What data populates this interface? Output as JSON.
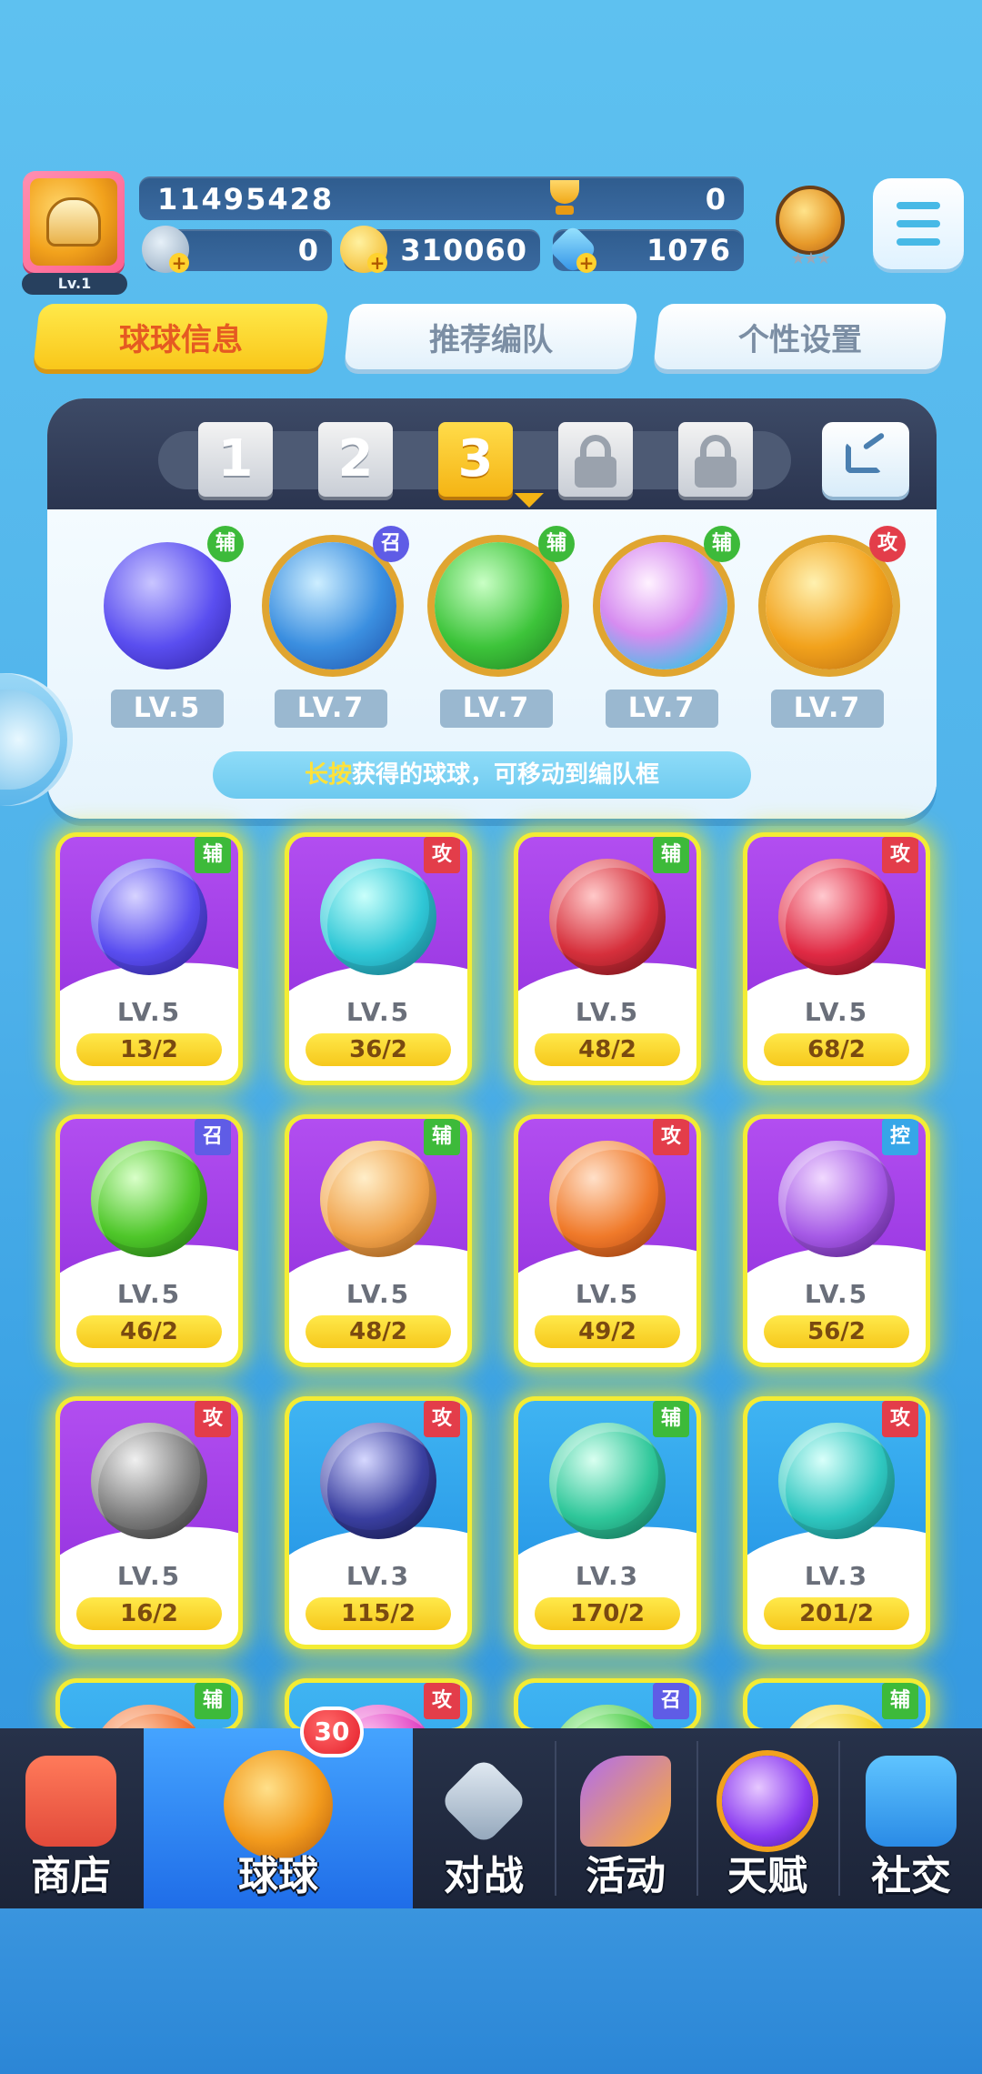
{
  "player": {
    "level": "Lv.1",
    "score": "11495428",
    "trophies": "0"
  },
  "resources": {
    "energy": "0",
    "coins": "310060",
    "gems": "1076"
  },
  "tabs": {
    "ball_info": "球球信息",
    "recommended_team": "推荐编队",
    "personal_settings": "个性设置"
  },
  "team_slots": [
    "1",
    "2",
    "3"
  ],
  "team": [
    {
      "level": "LV.5",
      "tag": "辅",
      "tag_color": "#3dba3a"
    },
    {
      "level": "LV.7",
      "tag": "召",
      "tag_color": "#5f5ce6"
    },
    {
      "level": "LV.7",
      "tag": "辅",
      "tag_color": "#3dba3a"
    },
    {
      "level": "LV.7",
      "tag": "辅",
      "tag_color": "#3dba3a"
    },
    {
      "level": "LV.7",
      "tag": "攻",
      "tag_color": "#e33d4a"
    }
  ],
  "hint": {
    "highlight": "长按",
    "text": "获得的球球，可移动到编队框"
  },
  "cards": [
    {
      "level": "LV.5",
      "count": "13/2",
      "tag": "辅",
      "tag_color": "#3dba3a"
    },
    {
      "level": "LV.5",
      "count": "36/2",
      "tag": "攻",
      "tag_color": "#e33d4a"
    },
    {
      "level": "LV.5",
      "count": "48/2",
      "tag": "辅",
      "tag_color": "#3dba3a"
    },
    {
      "level": "LV.5",
      "count": "68/2",
      "tag": "攻",
      "tag_color": "#e33d4a"
    },
    {
      "level": "LV.5",
      "count": "46/2",
      "tag": "召",
      "tag_color": "#5f5ce6"
    },
    {
      "level": "LV.5",
      "count": "48/2",
      "tag": "辅",
      "tag_color": "#3dba3a"
    },
    {
      "level": "LV.5",
      "count": "49/2",
      "tag": "攻",
      "tag_color": "#e33d4a"
    },
    {
      "level": "LV.5",
      "count": "56/2",
      "tag": "控",
      "tag_color": "#36a6e8"
    },
    {
      "level": "LV.5",
      "count": "16/2",
      "tag": "攻",
      "tag_color": "#e33d4a"
    },
    {
      "level": "LV.3",
      "count": "115/2",
      "tag": "攻",
      "tag_color": "#e33d4a"
    },
    {
      "level": "LV.3",
      "count": "170/2",
      "tag": "辅",
      "tag_color": "#3dba3a"
    },
    {
      "level": "LV.3",
      "count": "201/2",
      "tag": "攻",
      "tag_color": "#e33d4a"
    },
    {
      "level": "",
      "count": "",
      "tag": "辅",
      "tag_color": "#3dba3a"
    },
    {
      "level": "",
      "count": "",
      "tag": "攻",
      "tag_color": "#e33d4a"
    },
    {
      "level": "",
      "count": "",
      "tag": "召",
      "tag_color": "#5f5ce6"
    },
    {
      "level": "",
      "count": "",
      "tag": "辅",
      "tag_color": "#3dba3a"
    }
  ],
  "nav": {
    "shop": "商店",
    "balls": "球球",
    "balls_badge": "30",
    "battle": "对战",
    "events": "活动",
    "talent": "天赋",
    "social": "社交"
  },
  "icons": {
    "avatar": "gold-helmet-icon",
    "trophy": "trophy-icon",
    "energy": "energy-orb-icon",
    "coins": "coin-icon",
    "gems": "gem-icon",
    "rank": "rank-medal-icon",
    "menu": "menu-icon",
    "share": "share-icon",
    "lock": "lock-icon"
  }
}
